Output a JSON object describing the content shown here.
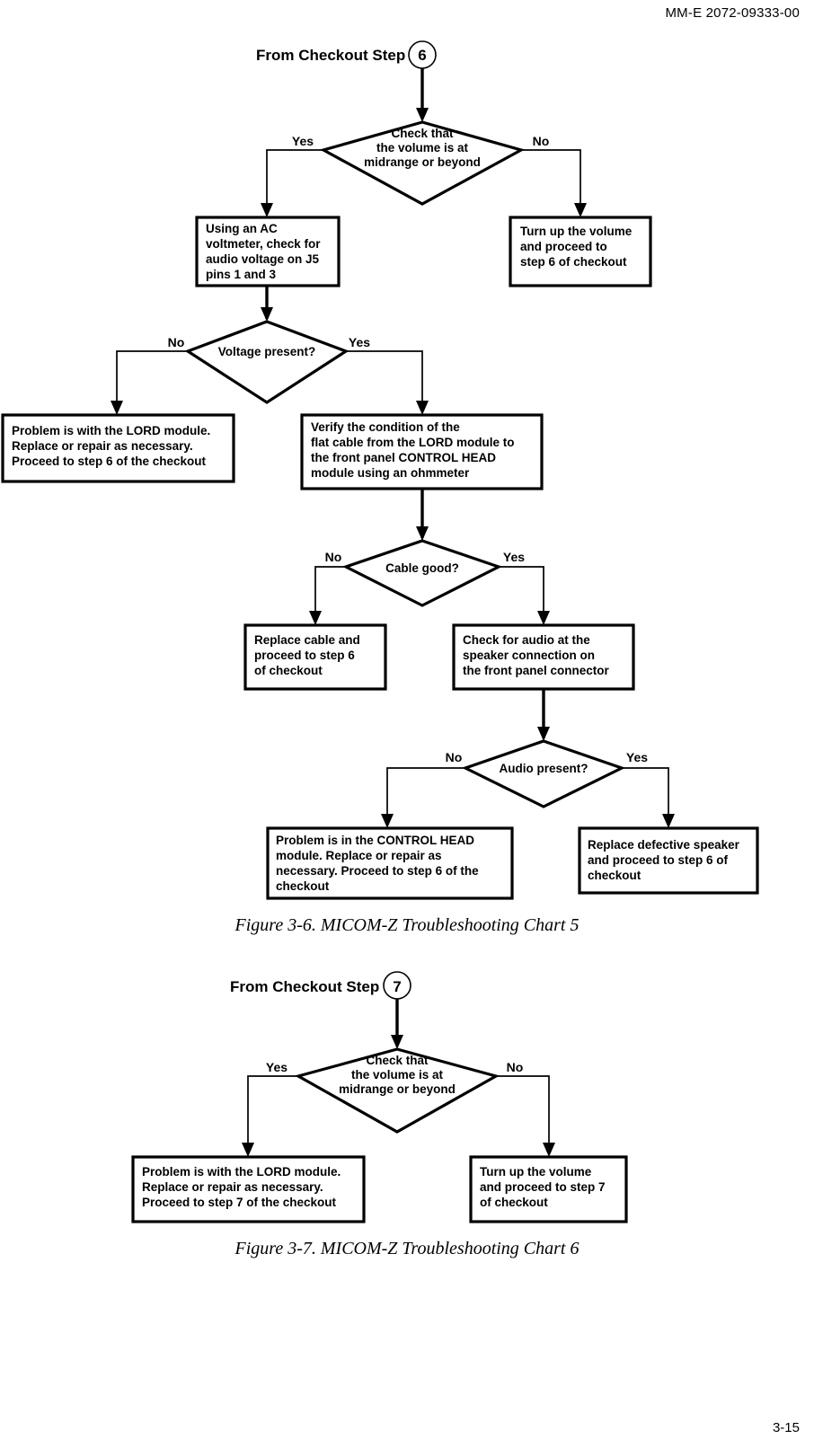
{
  "document": {
    "header": "MM-E 2072-09333-00",
    "page_number": "3-15"
  },
  "figures": [
    {
      "caption": "Figure 3-6. MICOM-Z Troubleshooting Chart 5",
      "entry": {
        "label": "From Checkout Step",
        "step": "6"
      },
      "decisions": {
        "d1": {
          "line1": "Check that",
          "line2": "the volume is at",
          "line3": "midrange or beyond",
          "left": "Yes",
          "right": "No"
        },
        "d2": {
          "text": "Voltage present?",
          "left": "No",
          "right": "Yes"
        },
        "d3": {
          "text": "Cable good?",
          "left": "No",
          "right": "Yes"
        },
        "d4": {
          "text": "Audio present?",
          "left": "No",
          "right": "Yes"
        }
      },
      "boxes": {
        "b_ac_voltmeter": [
          "Using an AC",
          "voltmeter, check for",
          "audio voltage on J5",
          "pins 1 and 3"
        ],
        "b_turn_up_volume": [
          "Turn up the volume",
          "and proceed to",
          "step 6 of checkout"
        ],
        "b_lord_module": [
          "Problem is with the LORD module.",
          "Replace or repair as necessary.",
          "Proceed to step 6 of the checkout"
        ],
        "b_verify_cable": [
          "Verify the condition of the",
          "flat cable from the LORD module to",
          "the front panel CONTROL HEAD",
          "module using an ohmmeter"
        ],
        "b_replace_cable": [
          "Replace cable and",
          "proceed to step 6",
          "of checkout"
        ],
        "b_check_audio": [
          "Check for audio at the",
          "speaker connection on",
          "the front panel connector"
        ],
        "b_control_head": [
          "Problem is in the CONTROL HEAD",
          "module. Replace or repair as",
          "necessary. Proceed to step 6 of the",
          "checkout"
        ],
        "b_replace_speaker": [
          "Replace defective speaker",
          "and proceed to step 6 of",
          "checkout"
        ]
      }
    },
    {
      "caption": "Figure 3-7. MICOM-Z Troubleshooting Chart 6",
      "entry": {
        "label": "From Checkout Step",
        "step": "7"
      },
      "decisions": {
        "d1": {
          "line1": "Check that",
          "line2": "the volume is at",
          "line3": "midrange or beyond",
          "left": "Yes",
          "right": "No"
        }
      },
      "boxes": {
        "b_lord_module": [
          "Problem is with the LORD module.",
          "Replace or repair as necessary.",
          "Proceed to step 7 of the checkout"
        ],
        "b_turn_up_volume": [
          "Turn up the volume",
          "and proceed to step 7",
          "of checkout"
        ]
      }
    }
  ]
}
